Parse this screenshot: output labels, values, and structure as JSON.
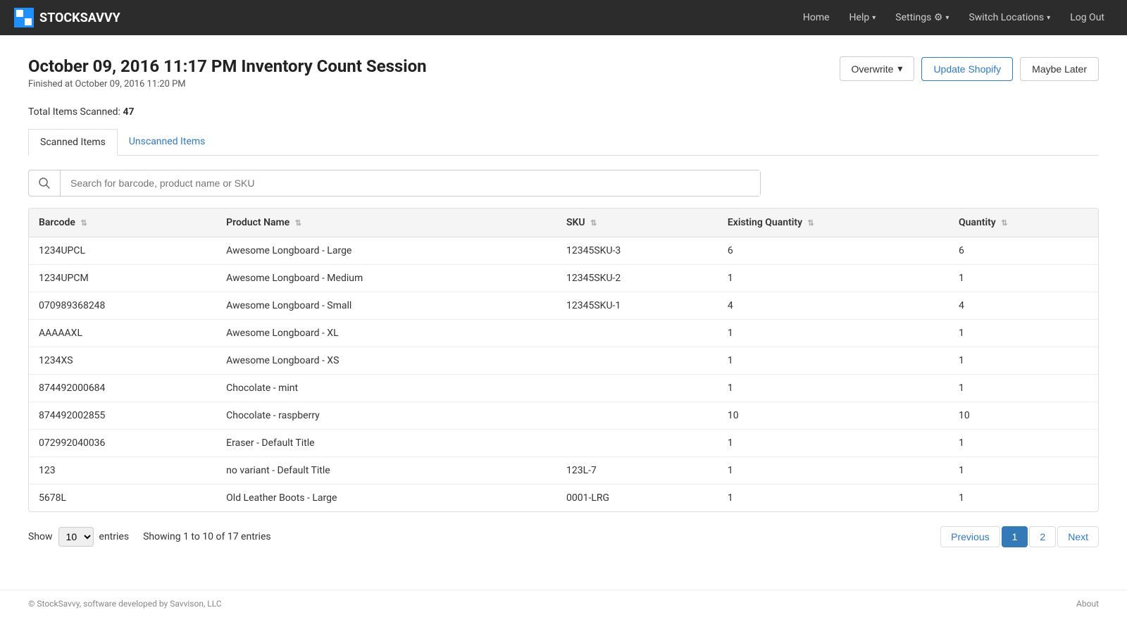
{
  "navbar": {
    "brand": "STOCKSAVVY",
    "logo_text": "SS",
    "nav_items": [
      {
        "label": "Home",
        "href": "#",
        "dropdown": false
      },
      {
        "label": "Help",
        "href": "#",
        "dropdown": true
      },
      {
        "label": "Settings",
        "href": "#",
        "dropdown": true,
        "icon": "⚙"
      },
      {
        "label": "Switch Locations",
        "href": "#",
        "dropdown": true
      },
      {
        "label": "Log Out",
        "href": "#",
        "dropdown": false
      }
    ]
  },
  "page": {
    "title": "October 09, 2016 11:17 PM Inventory Count Session",
    "subtitle": "Finished at October 09, 2016 11:20 PM",
    "total_items_label": "Total Items Scanned:",
    "total_items_value": "47"
  },
  "actions": {
    "overwrite_label": "Overwrite",
    "update_shopify_label": "Update Shopify",
    "maybe_later_label": "Maybe Later"
  },
  "tabs": [
    {
      "label": "Scanned Items",
      "active": true
    },
    {
      "label": "Unscanned Items",
      "active": false
    }
  ],
  "search": {
    "placeholder": "Search for barcode, product name or SKU"
  },
  "table": {
    "columns": [
      {
        "label": "Barcode",
        "sortable": true
      },
      {
        "label": "Product Name",
        "sortable": true
      },
      {
        "label": "SKU",
        "sortable": true
      },
      {
        "label": "Existing Quantity",
        "sortable": true
      },
      {
        "label": "Quantity",
        "sortable": true
      }
    ],
    "rows": [
      {
        "barcode": "1234UPCL",
        "product_name": "Awesome Longboard - Large",
        "sku": "12345SKU-3",
        "existing_qty": "6",
        "qty": "6"
      },
      {
        "barcode": "1234UPCM",
        "product_name": "Awesome Longboard - Medium",
        "sku": "12345SKU-2",
        "existing_qty": "1",
        "qty": "1"
      },
      {
        "barcode": "070989368248",
        "product_name": "Awesome Longboard - Small",
        "sku": "12345SKU-1",
        "existing_qty": "4",
        "qty": "4"
      },
      {
        "barcode": "AAAAAXL",
        "product_name": "Awesome Longboard - XL",
        "sku": "",
        "existing_qty": "1",
        "qty": "1"
      },
      {
        "barcode": "1234XS",
        "product_name": "Awesome Longboard - XS",
        "sku": "",
        "existing_qty": "1",
        "qty": "1"
      },
      {
        "barcode": "874492000684",
        "product_name": "Chocolate - mint",
        "sku": "",
        "existing_qty": "1",
        "qty": "1"
      },
      {
        "barcode": "874492002855",
        "product_name": "Chocolate - raspberry",
        "sku": "",
        "existing_qty": "10",
        "qty": "10"
      },
      {
        "barcode": "072992040036",
        "product_name": "Eraser - Default Title",
        "sku": "",
        "existing_qty": "1",
        "qty": "1"
      },
      {
        "barcode": "123",
        "product_name": "no variant - Default Title",
        "sku": "123L-7",
        "existing_qty": "1",
        "qty": "1"
      },
      {
        "barcode": "5678L",
        "product_name": "Old Leather Boots - Large",
        "sku": "0001-LRG",
        "existing_qty": "1",
        "qty": "1"
      }
    ]
  },
  "pagination": {
    "show_label": "Show",
    "entries_label": "entries",
    "show_value": "10",
    "info": "Showing 1 to 10 of 17 entries",
    "previous_label": "Previous",
    "next_label": "Next",
    "pages": [
      "1",
      "2"
    ],
    "current_page": "1"
  },
  "footer": {
    "copyright": "© StockSavvy, software developed by Savvison, LLC",
    "about_label": "About"
  }
}
